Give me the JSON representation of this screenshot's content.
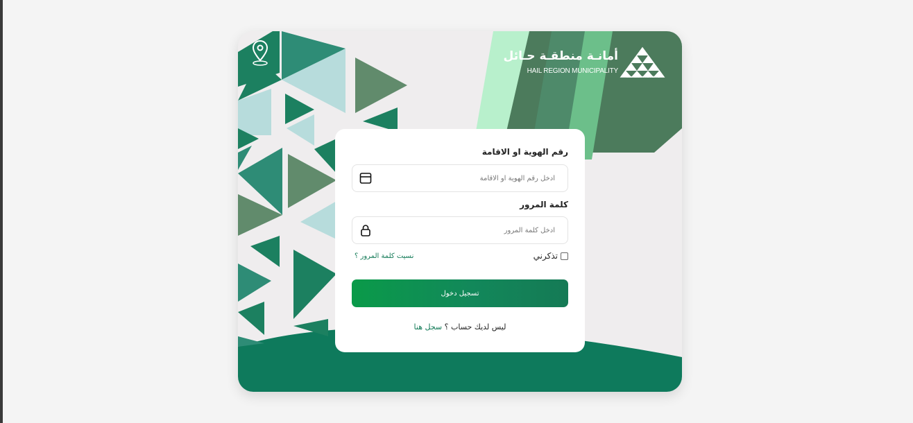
{
  "brand": {
    "name_ar": "أمانـة منطقـة حـائل",
    "name_en": "HAIL REGION MUNICIPALITY",
    "mark_caption": "HAIL REGION MUNICIPALITY",
    "logo_icon": "triangles-logo",
    "pin_icon": "location-pin-icon"
  },
  "colors": {
    "primary": "#0a9a49",
    "dark_green": "#0e7a5c",
    "link": "#137a57",
    "card_bg": "#efedee"
  },
  "form": {
    "id_label": "رقم الهوية او الاقامة",
    "id_placeholder": "ادخل رقم الهوية او الاقامة",
    "id_value": "",
    "id_icon": "id-card-icon",
    "password_label": "كلمة المرور",
    "password_placeholder": "ادخل كلمة المرور",
    "password_value": "",
    "password_icon": "lock-icon",
    "remember_label": "تذكرني",
    "remember_checked": false,
    "forgot_label": "نسيت كلمة المرور ؟",
    "login_label": "تسجيل دخول",
    "no_account_text": "ليس لديك حساب ؟",
    "signup_label": "سجل هنا"
  }
}
